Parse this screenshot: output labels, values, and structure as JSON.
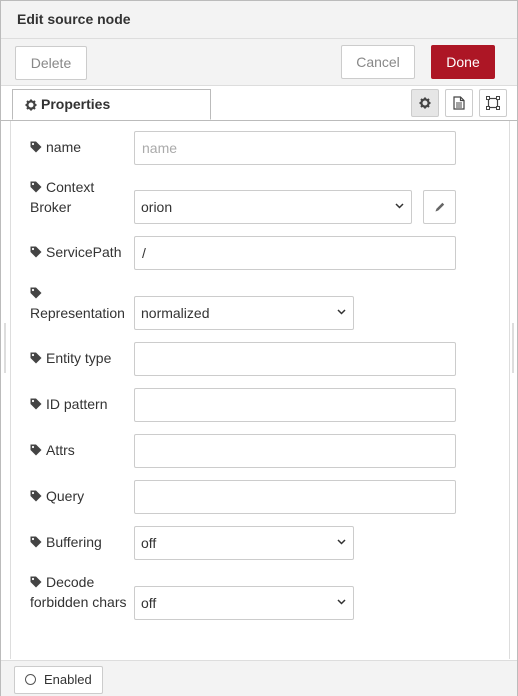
{
  "header": {
    "title": "Edit source node"
  },
  "toolbar": {
    "delete_label": "Delete",
    "cancel_label": "Cancel",
    "done_label": "Done",
    "done_color": "#ad1625"
  },
  "tabs": {
    "properties_label": "Properties"
  },
  "fields": {
    "name": {
      "label": "name",
      "placeholder": "name",
      "value": ""
    },
    "context_broker": {
      "label_line1": "Context",
      "label_line2": "Broker",
      "value": "orion"
    },
    "service_path": {
      "label": "ServicePath",
      "value": "/"
    },
    "representation": {
      "label": "Representation",
      "value": "normalized"
    },
    "entity_type": {
      "label": "Entity type",
      "value": ""
    },
    "id_pattern": {
      "label": "ID pattern",
      "value": ""
    },
    "attrs": {
      "label": "Attrs",
      "value": ""
    },
    "query": {
      "label": "Query",
      "value": ""
    },
    "buffering": {
      "label": "Buffering",
      "value": "off"
    },
    "decode": {
      "label_line1": "Decode",
      "label_line2": "forbidden chars",
      "value": "off"
    }
  },
  "footer": {
    "enabled_label": "Enabled"
  },
  "icons": {
    "tab_settings": "gear-icon",
    "tab_description": "document-icon",
    "tab_appearance": "frame-icon",
    "field_tag": "tag-icon",
    "broker_edit": "pencil-icon",
    "enabled_state": "circle-icon"
  }
}
